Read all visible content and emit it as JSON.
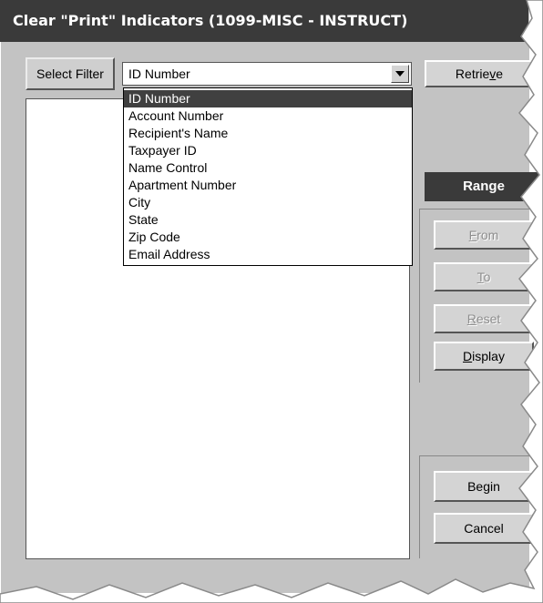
{
  "window": {
    "title": "Clear \"Print\" Indicators (1099-MISC - INSTRUCT)"
  },
  "filter": {
    "select_filter_label": "Select Filter",
    "selected_value": "ID Number",
    "options": [
      "ID Number",
      "Account Number",
      "Recipient's Name",
      "Taxpayer ID",
      "Name Control",
      "Apartment Number",
      "City",
      "State",
      "Zip Code",
      "Email Address"
    ]
  },
  "buttons": {
    "retrieve": {
      "pre": "Retrie",
      "key": "v",
      "post": "e"
    },
    "from": {
      "pre": "",
      "key": "F",
      "post": "rom"
    },
    "to": {
      "pre": "",
      "key": "T",
      "post": "o"
    },
    "reset": {
      "pre": "",
      "key": "R",
      "post": "eset"
    },
    "display": {
      "pre": "",
      "key": "D",
      "post": "isplay"
    },
    "begin": "Begin",
    "cancel": "Cancel"
  },
  "range": {
    "header": "Range"
  },
  "colors": {
    "titlebar": "#3a3a3a",
    "window": "#c3c3c3",
    "selection": "#404040"
  }
}
